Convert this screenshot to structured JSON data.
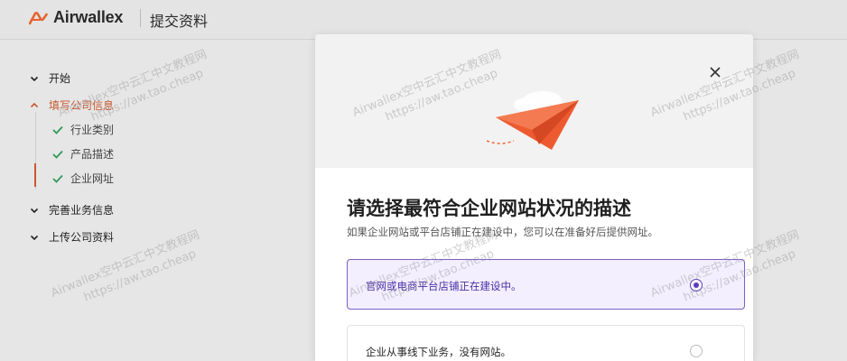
{
  "header": {
    "brand": "Airwallex",
    "page_title": "提交资料"
  },
  "sidebar": {
    "sections": [
      {
        "label": "开始",
        "state": "collapsed"
      },
      {
        "label": "填写公司信息",
        "state": "expanded"
      },
      {
        "label": "完善业务信息",
        "state": "collapsed"
      },
      {
        "label": "上传公司资料",
        "state": "collapsed"
      }
    ],
    "sub_items": [
      {
        "label": "行业类别",
        "done": true
      },
      {
        "label": "产品描述",
        "done": true
      },
      {
        "label": "企业网址",
        "done": true,
        "current": true
      }
    ]
  },
  "modal": {
    "title": "请选择最符合企业网站状况的描述",
    "subtitle": "如果企业网站或平台店铺正在建设中，您可以在准备好后提供网址。",
    "options": [
      {
        "label": "官网或电商平台店铺正在建设中。",
        "selected": true
      },
      {
        "label": "企业从事线下业务，没有网站。",
        "selected": false
      }
    ]
  },
  "watermark": {
    "line1": "Airwallex空中云汇中文教程网",
    "line2": "https://aw.tao.cheap"
  },
  "colors": {
    "accent": "#c8582f",
    "selected_border": "#7b5ec7",
    "selected_bg": "#f3efff",
    "check": "#2e9a5a",
    "plane": "#ee5a2f"
  }
}
